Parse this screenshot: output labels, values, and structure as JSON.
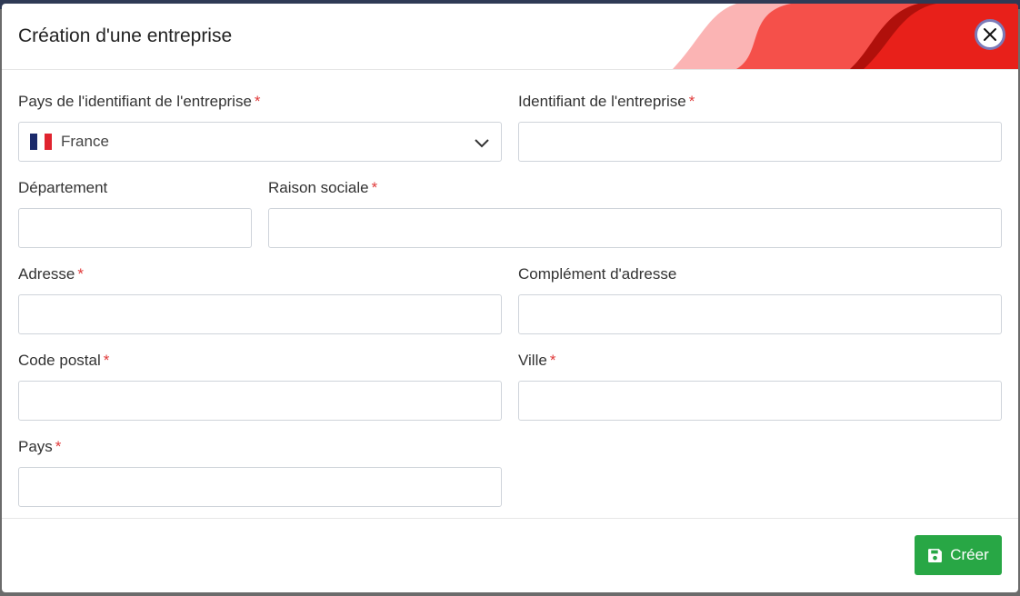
{
  "modal": {
    "title": "Création d'une entreprise",
    "close_icon": "close-icon",
    "accent_colors": [
      "#fbb4b4",
      "#f5504a",
      "#e8201a"
    ]
  },
  "form": {
    "country_id": {
      "label": "Pays de l'identifiant de l'entreprise",
      "required": "*",
      "value": "France",
      "flag_icon": "france-flag-icon"
    },
    "company_id": {
      "label": "Identifiant de l'entreprise",
      "required": "*",
      "value": ""
    },
    "department": {
      "label": "Département",
      "value": ""
    },
    "company_name": {
      "label": "Raison sociale",
      "required": "*",
      "value": ""
    },
    "address": {
      "label": "Adresse",
      "required": "*",
      "value": ""
    },
    "address_complement": {
      "label": "Complément d'adresse",
      "value": ""
    },
    "postal_code": {
      "label": "Code postal",
      "required": "*",
      "value": ""
    },
    "city": {
      "label": "Ville",
      "required": "*",
      "value": ""
    },
    "country": {
      "label": "Pays",
      "required": "*",
      "value": ""
    }
  },
  "footer": {
    "create_label": "Créer",
    "create_icon": "save-icon",
    "create_color": "#28a745"
  }
}
